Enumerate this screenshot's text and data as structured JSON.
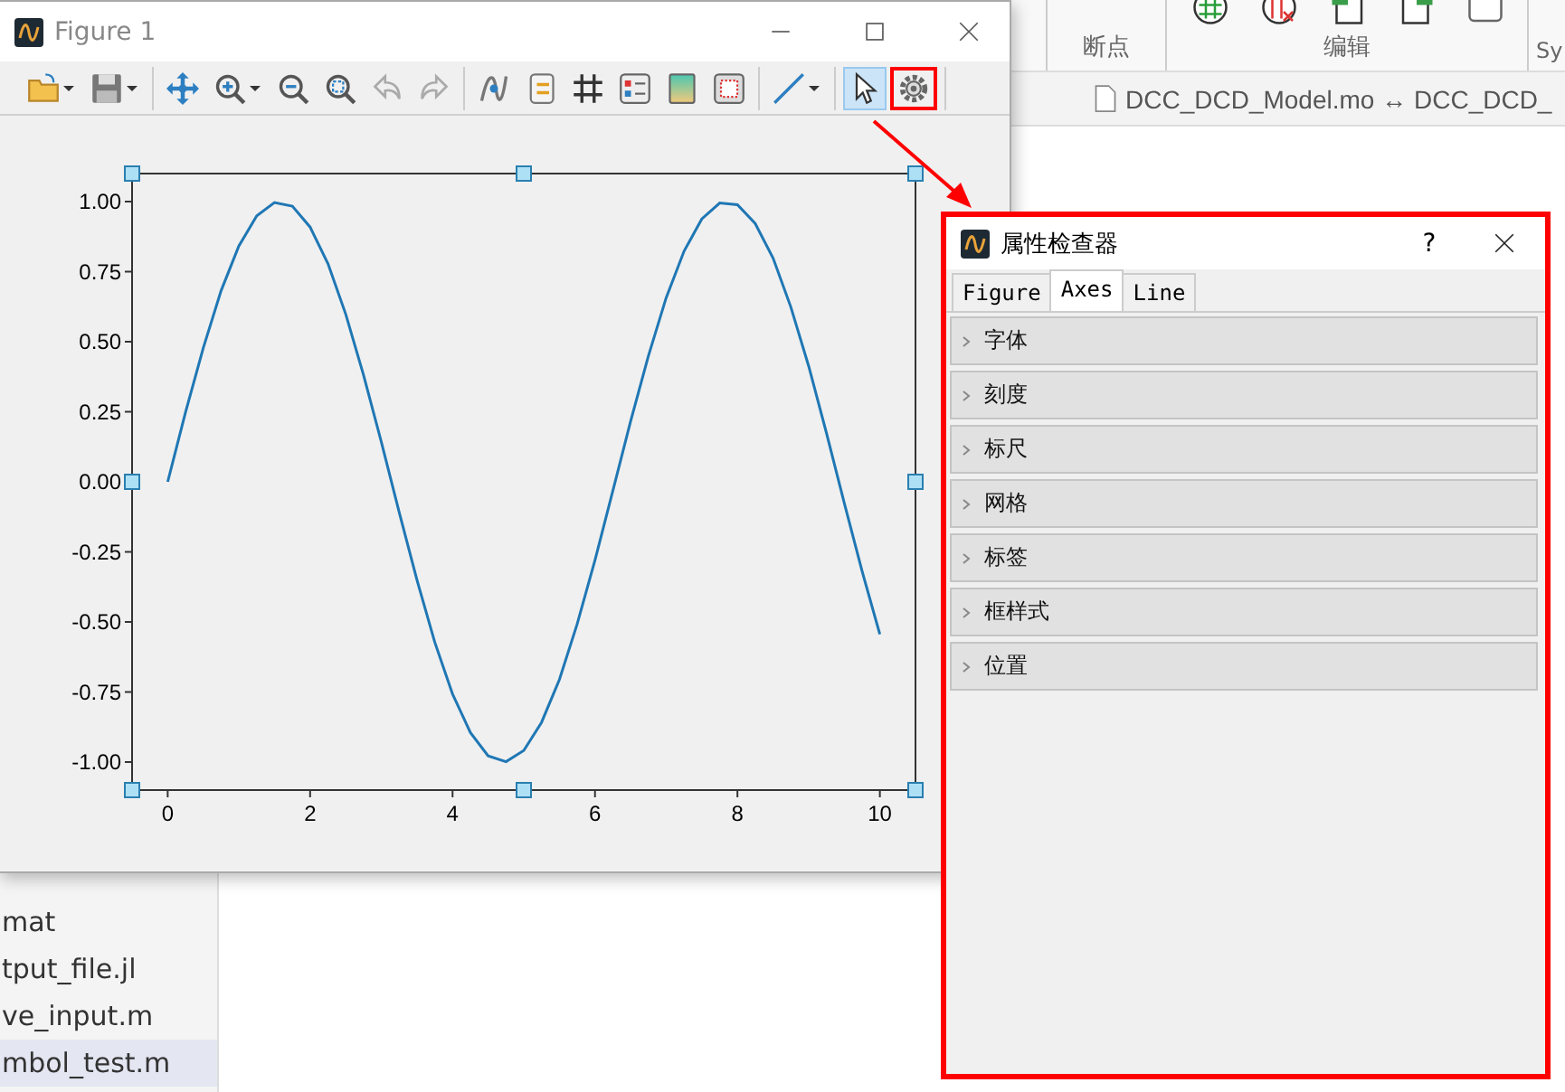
{
  "background_app": {
    "ribbon_groups": [
      {
        "label": "断点"
      },
      {
        "label": "编辑"
      },
      {
        "label": "Sy"
      }
    ],
    "file_tab": {
      "label": "DCC_DCD_Model.mo ↔ DCC_DCD_"
    },
    "file_list": [
      {
        "name": "mat",
        "selected": false
      },
      {
        "name": "tput_file.jl",
        "selected": false
      },
      {
        "name": "ve_input.m",
        "selected": false
      },
      {
        "name": "mbol_test.m",
        "selected": true
      }
    ]
  },
  "figure_window": {
    "title": "Figure 1",
    "toolbar": [
      {
        "tools": [
          {
            "kind": "open",
            "dropdown": true,
            "selected": false,
            "annotated": false
          },
          {
            "kind": "save",
            "dropdown": true,
            "selected": false,
            "annotated": false
          }
        ]
      },
      {
        "tools": [
          {
            "kind": "pan",
            "dropdown": false,
            "selected": false,
            "annotated": false
          },
          {
            "kind": "zoom-in",
            "dropdown": true,
            "selected": false,
            "annotated": false
          },
          {
            "kind": "zoom-out",
            "dropdown": false,
            "selected": false,
            "annotated": false
          },
          {
            "kind": "zoom-fit",
            "dropdown": false,
            "selected": false,
            "annotated": false
          },
          {
            "kind": "back",
            "dropdown": false,
            "selected": false,
            "annotated": false
          },
          {
            "kind": "forward",
            "dropdown": false,
            "selected": false,
            "annotated": false
          }
        ]
      },
      {
        "tools": [
          {
            "kind": "curve",
            "dropdown": false,
            "selected": false,
            "annotated": false
          },
          {
            "kind": "legend",
            "dropdown": false,
            "selected": false,
            "annotated": false
          },
          {
            "kind": "grid",
            "dropdown": false,
            "selected": false,
            "annotated": false
          },
          {
            "kind": "sliders",
            "dropdown": false,
            "selected": false,
            "annotated": false
          },
          {
            "kind": "color",
            "dropdown": false,
            "selected": false,
            "annotated": false
          },
          {
            "kind": "frame",
            "dropdown": false,
            "selected": false,
            "annotated": false
          }
        ]
      },
      {
        "tools": [
          {
            "kind": "line",
            "dropdown": true,
            "selected": false,
            "annotated": false
          }
        ]
      },
      {
        "tools": [
          {
            "kind": "pointer",
            "dropdown": false,
            "selected": true,
            "annotated": false
          },
          {
            "kind": "gear",
            "dropdown": false,
            "selected": false,
            "annotated": true
          }
        ]
      }
    ],
    "chart_data": {
      "type": "line",
      "xlim": [
        -0.5,
        10.5
      ],
      "ylim": [
        -1.1,
        1.1
      ],
      "xticks": [
        0,
        2,
        4,
        6,
        8,
        10
      ],
      "yticks": [
        {
          "value": 1,
          "label": "1.00"
        },
        {
          "value": 0.75,
          "label": "0.75"
        },
        {
          "value": 0.5,
          "label": "0.50"
        },
        {
          "value": 0.25,
          "label": "0.25"
        },
        {
          "value": 0,
          "label": "0.00"
        },
        {
          "value": -0.25,
          "label": "-0.25"
        },
        {
          "value": -0.5,
          "label": "-0.50"
        },
        {
          "value": -0.75,
          "label": "-0.75"
        },
        {
          "value": -1,
          "label": "-1.00"
        }
      ],
      "x": [
        0,
        0.25,
        0.5,
        0.75,
        1,
        1.25,
        1.5,
        1.75,
        2,
        2.25,
        2.5,
        2.75,
        3,
        3.25,
        3.5,
        3.75,
        4,
        4.25,
        4.5,
        4.75,
        5,
        5.25,
        5.5,
        5.75,
        6,
        6.25,
        6.5,
        6.75,
        7,
        7.25,
        7.5,
        7.75,
        8,
        8.25,
        8.5,
        8.75,
        9,
        9.25,
        9.5,
        9.75,
        10
      ],
      "series": [
        {
          "color": "#1f77b4",
          "values": [
            0,
            0.247,
            0.479,
            0.682,
            0.841,
            0.949,
            0.997,
            0.984,
            0.909,
            0.778,
            0.598,
            0.382,
            0.141,
            -0.108,
            -0.351,
            -0.572,
            -0.757,
            -0.895,
            -0.978,
            -0.999,
            -0.959,
            -0.859,
            -0.706,
            -0.508,
            -0.279,
            -0.033,
            0.215,
            0.45,
            0.657,
            0.823,
            0.938,
            0.995,
            0.989,
            0.922,
            0.798,
            0.624,
            0.412,
            0.174,
            -0.075,
            -0.319,
            -0.544
          ]
        }
      ]
    }
  },
  "inspector": {
    "title": "属性检查器",
    "help": "?",
    "annotated": true,
    "tabs": [
      {
        "label": "Figure",
        "selected": false
      },
      {
        "label": "Axes",
        "selected": true
      },
      {
        "label": "Line",
        "selected": false
      }
    ],
    "sections": [
      {
        "label": "字体",
        "expanded": false
      },
      {
        "label": "刻度",
        "expanded": false
      },
      {
        "label": "标尺",
        "expanded": false
      },
      {
        "label": "网格",
        "expanded": false
      },
      {
        "label": "标签",
        "expanded": false
      },
      {
        "label": "框样式",
        "expanded": false
      },
      {
        "label": "位置",
        "expanded": false
      }
    ]
  }
}
